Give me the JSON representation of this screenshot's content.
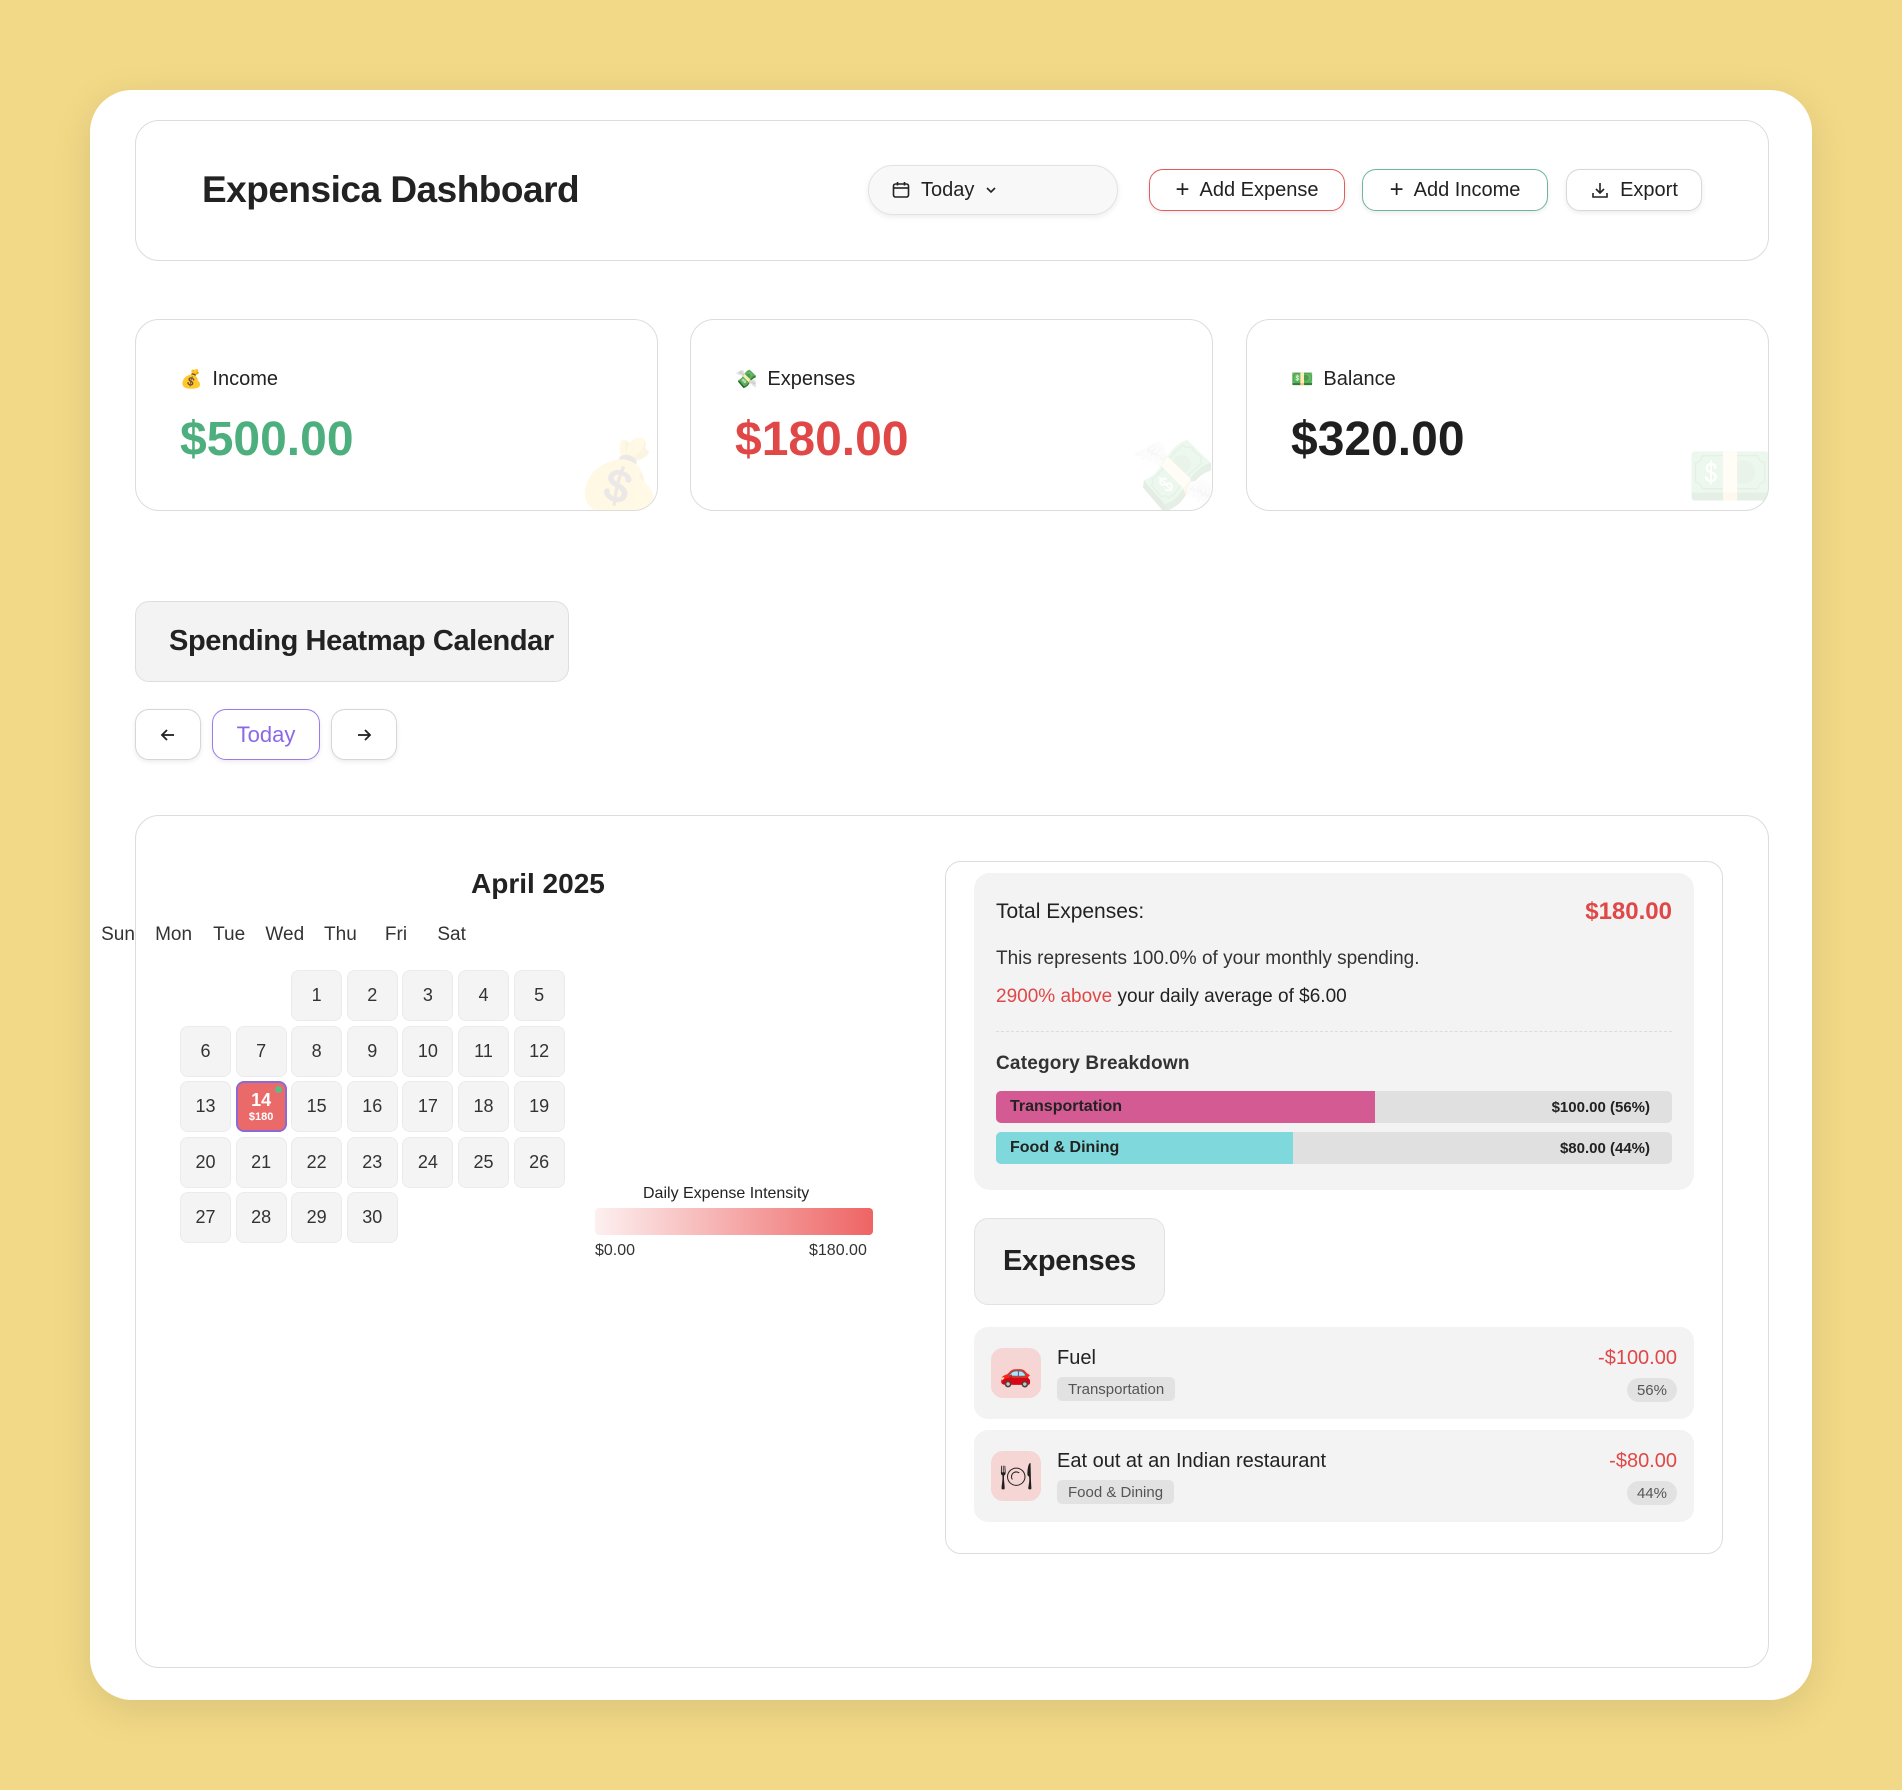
{
  "header": {
    "title": "Expensica Dashboard",
    "date_filter": "Today",
    "add_expense": "Add Expense",
    "add_income": "Add Income",
    "export": "Export"
  },
  "stats": {
    "income": {
      "label": "Income",
      "value": "$500.00",
      "icon": "money-bag-icon",
      "color": "#4caf7d"
    },
    "expenses": {
      "label": "Expenses",
      "value": "$180.00",
      "icon": "money-with-wings-icon",
      "color": "#e04848"
    },
    "balance": {
      "label": "Balance",
      "value": "$320.00",
      "icon": "dollar-banknote-icon",
      "color": "#1f1f1f"
    }
  },
  "heatmap": {
    "title": "Spending Heatmap Calendar",
    "today_button": "Today",
    "month": "April 2025",
    "weekdays": [
      "Sun",
      "Mon",
      "Tue",
      "Wed",
      "Thu",
      "Fri",
      "Sat"
    ],
    "first_weekday_index": 2,
    "days_in_month": 30,
    "active_day": {
      "day": "14",
      "amount": "$180"
    },
    "legend_title": "Daily Expense Intensity",
    "legend_min": "$0.00",
    "legend_max": "$180.00"
  },
  "summary": {
    "total_label": "Total Expenses:",
    "total_value": "$180.00",
    "line1": "This represents 100.0% of your monthly spending.",
    "line2_highlight": "2900% above",
    "line2_rest": " your daily average of $6.00",
    "category_title": "Category Breakdown",
    "categories": [
      {
        "name": "Transportation",
        "amount": "$100.00 (56%)",
        "fraction": 0.56,
        "color": "#d45a94"
      },
      {
        "name": "Food & Dining",
        "amount": "$80.00 (44%)",
        "fraction": 0.44,
        "color": "#7fd9dc"
      }
    ]
  },
  "expenses": {
    "title": "Expenses",
    "items": [
      {
        "name": "Fuel",
        "category": "Transportation",
        "amount": "-$100.00",
        "percent": "56%",
        "icon": "car-icon"
      },
      {
        "name": "Eat out at an Indian restaurant",
        "category": "Food & Dining",
        "amount": "-$80.00",
        "percent": "44%",
        "icon": "plate-icon"
      }
    ]
  }
}
